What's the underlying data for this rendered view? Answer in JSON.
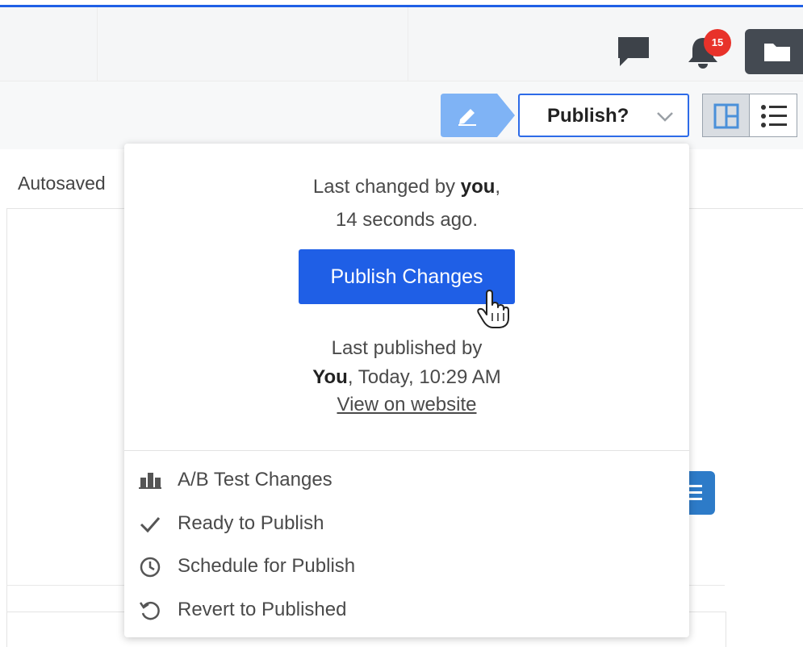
{
  "header": {
    "notification_count": "15",
    "icons": [
      "chat-icon",
      "bell-icon",
      "folder-icon"
    ]
  },
  "toolbar": {
    "publish_dropdown_label": "Publish?",
    "autosaved_label": "Autosaved"
  },
  "publish_panel": {
    "last_changed_prefix": "Last changed by ",
    "last_changed_user": "you",
    "last_changed_suffix": ",",
    "last_changed_time": "14 seconds ago.",
    "publish_button_label": "Publish Changes",
    "last_published_label": "Last published by",
    "last_published_user": "You",
    "last_published_time": ", Today, 10:29 AM",
    "view_link_label": "View on website",
    "menu_items": [
      {
        "label": "A/B Test Changes",
        "icon": "ab-test-icon"
      },
      {
        "label": "Ready to Publish",
        "icon": "checkmark-icon"
      },
      {
        "label": "Schedule for Publish",
        "icon": "clock-icon"
      },
      {
        "label": "Revert to Published",
        "icon": "revert-icon"
      }
    ]
  },
  "colors": {
    "accent_blue": "#1f5fe6",
    "badge_red": "#e8322a",
    "edit_chip_blue": "#7fb3f5"
  }
}
